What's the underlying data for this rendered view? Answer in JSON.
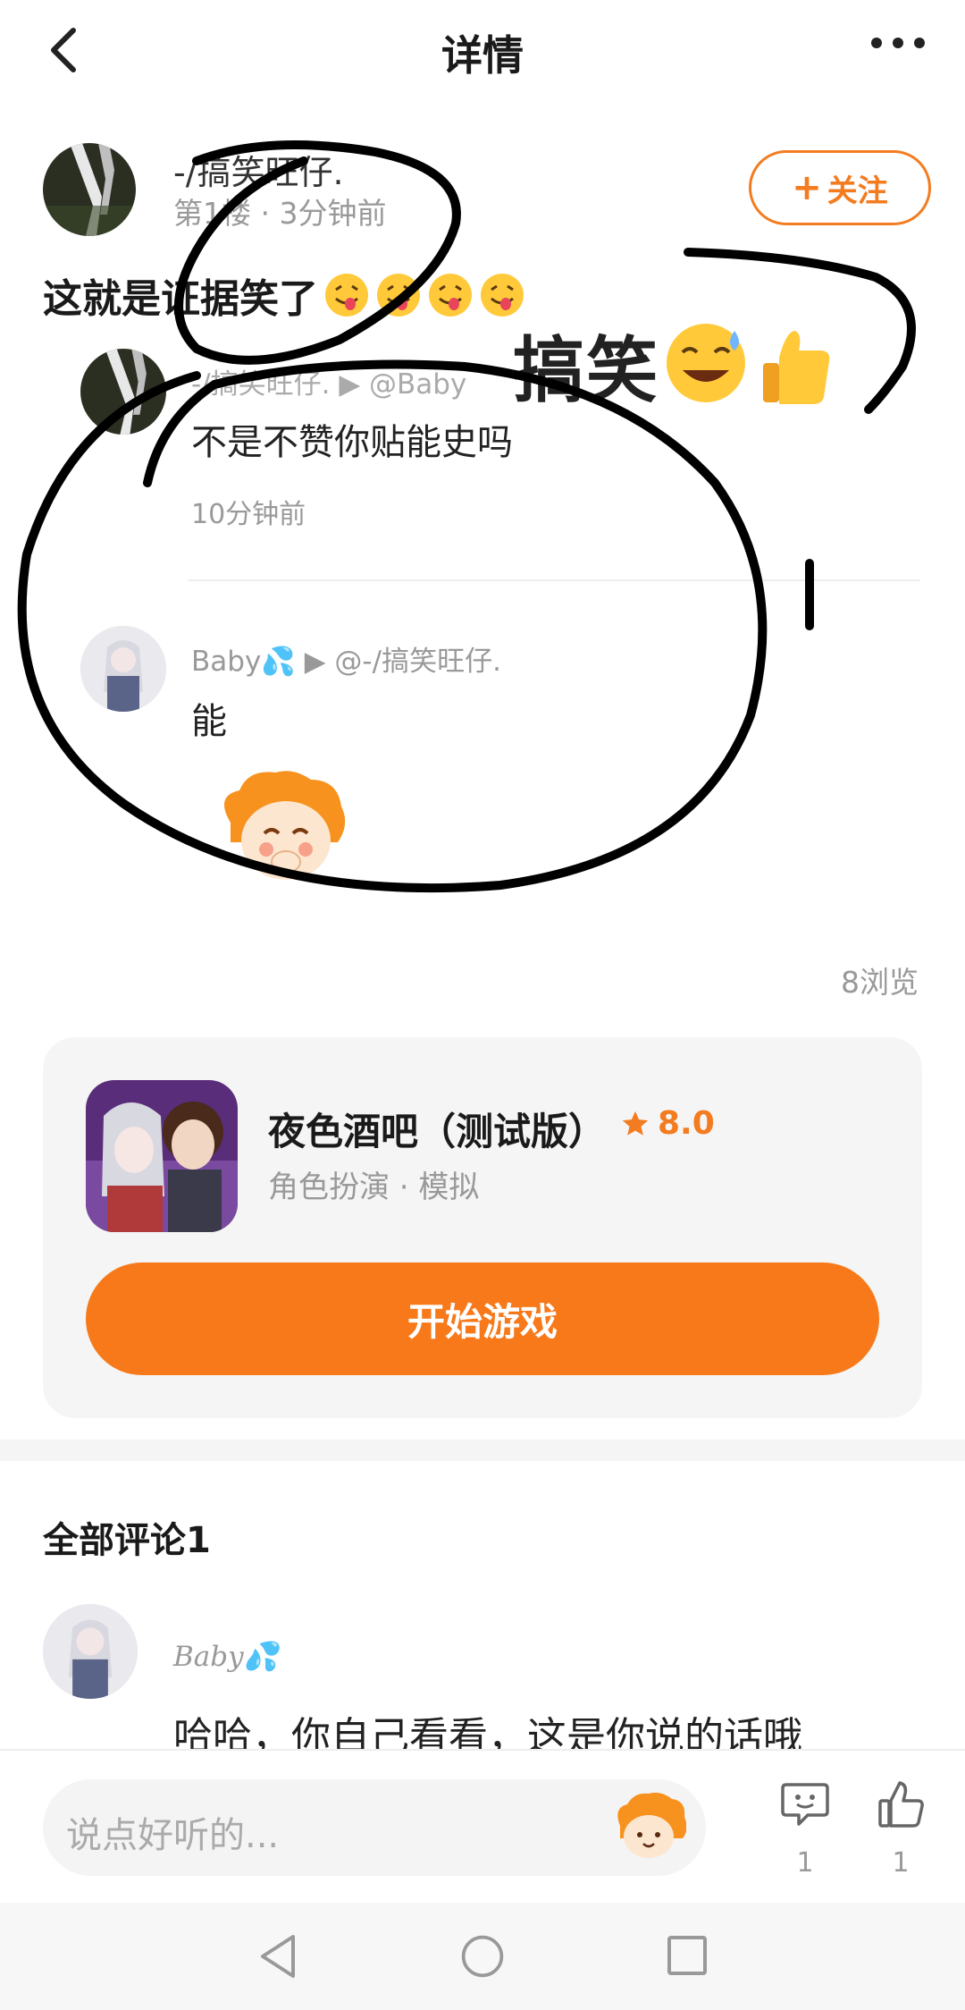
{
  "header": {
    "title": "详情"
  },
  "post": {
    "author_name": "-/搞笑旺仔.",
    "meta": "第1楼 · 3分钟前",
    "follow_label": "关注",
    "text": "这就是证据笑了",
    "emoji_count": 4,
    "overlay_text": "搞笑",
    "views": "8浏览"
  },
  "replies": [
    {
      "name": "-/搞笑旺仔. ▶ @Baby",
      "text": "不是不赞你贴能史吗",
      "time": "10分钟前"
    },
    {
      "name": "Baby💦 ▶ @-/搞笑旺仔.",
      "text": "能"
    }
  ],
  "game": {
    "name": "夜色酒吧（测试版）",
    "rating": "8.0",
    "tags": "角色扮演 · 模拟",
    "start_label": "开始游戏"
  },
  "comments": {
    "title": "全部评论1",
    "items": [
      {
        "name": "Baby💦",
        "text": "哈哈，你自己看看，这是你说的话哦"
      }
    ]
  },
  "bottom_bar": {
    "input_placeholder": "说点好听的...",
    "comment_count": "1",
    "like_count": "1"
  },
  "colors": {
    "accent": "#f7791a",
    "text_primary": "#1a1a1a",
    "text_secondary": "#999999",
    "card_bg": "#f5f5f5"
  }
}
